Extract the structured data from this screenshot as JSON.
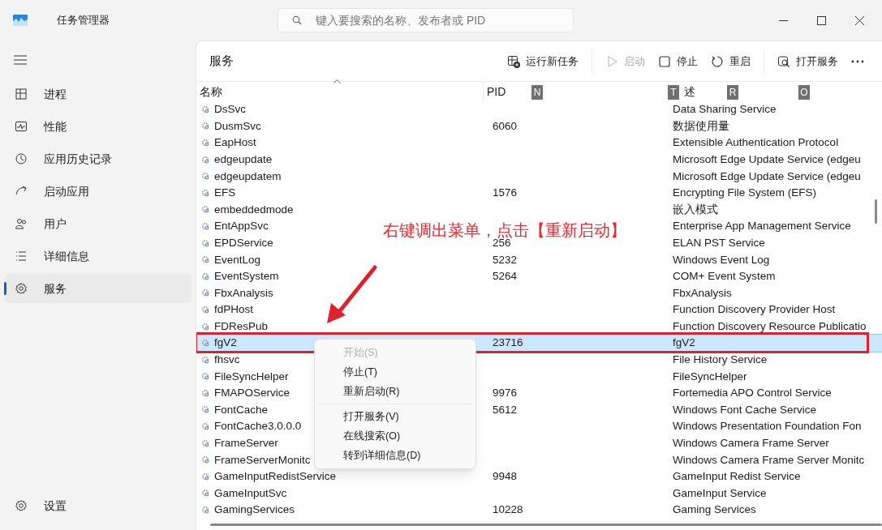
{
  "window": {
    "title": "任务管理器",
    "search_placeholder": "键入要搜索的名称、发布者或 PID"
  },
  "sidebar": {
    "items": [
      {
        "kind": "processes",
        "label": "进程",
        "selected": false
      },
      {
        "kind": "performance",
        "label": "性能",
        "selected": false
      },
      {
        "kind": "history",
        "label": "应用历史记录",
        "selected": false
      },
      {
        "kind": "startup",
        "label": "启动应用",
        "selected": false
      },
      {
        "kind": "users",
        "label": "用户",
        "selected": false
      },
      {
        "kind": "details",
        "label": "详细信息",
        "selected": false
      },
      {
        "kind": "services",
        "label": "服务",
        "selected": true
      }
    ],
    "settings": "设置"
  },
  "page": {
    "title": "服务",
    "toolbar": [
      {
        "kind": "run",
        "label": "运行新任务",
        "disabled": false
      },
      {
        "kind": "start",
        "label": "启动",
        "disabled": true
      },
      {
        "kind": "stop",
        "label": "停止",
        "disabled": false
      },
      {
        "kind": "restart",
        "label": "重启",
        "disabled": false
      },
      {
        "kind": "open",
        "label": "打开服务",
        "disabled": false
      },
      {
        "kind": "more",
        "disabled": false
      }
    ]
  },
  "table": {
    "columns": [
      {
        "label": "名称",
        "sorted": true
      },
      {
        "label": "PID"
      },
      {
        "label": "述"
      }
    ],
    "keytips": [
      "N",
      "T",
      "R",
      "O"
    ],
    "rows": [
      {
        "name": "DsSvc",
        "pid": "",
        "description": "Data Sharing Service",
        "selected": false
      },
      {
        "name": "DusmSvc",
        "pid": "6060",
        "description": "数据使用量",
        "selected": false
      },
      {
        "name": "EapHost",
        "pid": "",
        "description": "Extensible Authentication Protocol",
        "selected": false
      },
      {
        "name": "edgeupdate",
        "pid": "",
        "description": "Microsoft Edge Update Service (edgeu",
        "selected": false
      },
      {
        "name": "edgeupdatem",
        "pid": "",
        "description": "Microsoft Edge Update Service (edgeu",
        "selected": false
      },
      {
        "name": "EFS",
        "pid": "1576",
        "description": "Encrypting File System (EFS)",
        "selected": false
      },
      {
        "name": "embeddedmode",
        "pid": "",
        "description": "嵌入模式",
        "selected": false
      },
      {
        "name": "EntAppSvc",
        "pid": "",
        "description": "Enterprise App Management Service",
        "selected": false
      },
      {
        "name": "EPDService",
        "pid": "256",
        "description": "ELAN PST Service",
        "selected": false
      },
      {
        "name": "EventLog",
        "pid": "5232",
        "description": "Windows Event Log",
        "selected": false
      },
      {
        "name": "EventSystem",
        "pid": "5264",
        "description": "COM+ Event System",
        "selected": false
      },
      {
        "name": "FbxAnalysis",
        "pid": "",
        "description": "FbxAnalysis",
        "selected": false
      },
      {
        "name": "fdPHost",
        "pid": "",
        "description": "Function Discovery Provider Host",
        "selected": false
      },
      {
        "name": "FDResPub",
        "pid": "",
        "description": "Function Discovery Resource Publicatio",
        "selected": false
      },
      {
        "name": "fgV2",
        "pid": "23716",
        "description": "fgV2",
        "selected": true
      },
      {
        "name": "fhsvc",
        "pid": "",
        "description": "File History Service",
        "selected": false
      },
      {
        "name": "FileSyncHelper",
        "pid": "",
        "description": "FileSyncHelper",
        "selected": false
      },
      {
        "name": "FMAPOService",
        "pid": "9976",
        "description": "Fortemedia APO Control Service",
        "selected": false
      },
      {
        "name": "FontCache",
        "pid": "5612",
        "description": "Windows Font Cache Service",
        "selected": false
      },
      {
        "name": "FontCache3.0.0.0",
        "pid": "",
        "description": "Windows Presentation Foundation Fon",
        "selected": false
      },
      {
        "name": "FrameServer",
        "pid": "",
        "description": "Windows Camera Frame Server",
        "selected": false
      },
      {
        "name": "FrameServerMonitc",
        "pid": "",
        "description": "Windows Camera Frame Server Monitc",
        "selected": false
      },
      {
        "name": "GameInputRedistService",
        "pid": "9948",
        "description": "GameInput Redist Service",
        "selected": false
      },
      {
        "name": "GameInputSvc",
        "pid": "",
        "description": "GameInput Service",
        "selected": false
      },
      {
        "name": "GamingServices",
        "pid": "10228",
        "description": "Gaming Services",
        "selected": false
      }
    ]
  },
  "context_menu": {
    "items": [
      {
        "kind": "item",
        "label": "开始(S)",
        "disabled": true
      },
      {
        "kind": "item",
        "label": "停止(T)",
        "disabled": false
      },
      {
        "kind": "item",
        "label": "重新启动(R)",
        "disabled": false
      },
      {
        "kind": "separator"
      },
      {
        "kind": "item",
        "label": "打开服务(V)",
        "disabled": false
      },
      {
        "kind": "item",
        "label": "在线搜索(O)",
        "disabled": false
      },
      {
        "kind": "item",
        "label": "转到详细信息(D)",
        "disabled": false
      }
    ]
  },
  "annotation": {
    "text": "右键调出菜单，点击【重新启动】"
  }
}
